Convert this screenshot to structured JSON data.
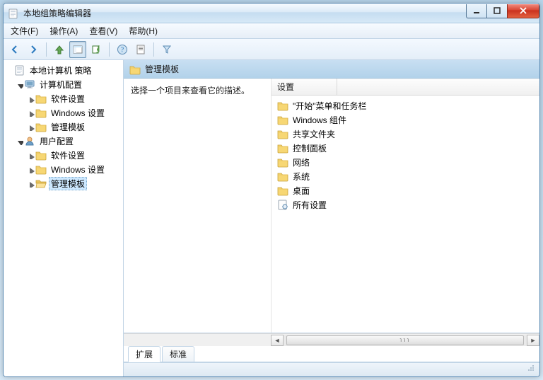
{
  "window": {
    "title": "本地组策略编辑器"
  },
  "menus": {
    "file": "文件(F)",
    "action": "操作(A)",
    "view": "查看(V)",
    "help": "帮助(H)"
  },
  "tree": {
    "root": "本地计算机 策略",
    "computer": {
      "label": "计算机配置",
      "software": "软件设置",
      "windows": "Windows 设置",
      "admin": "管理模板"
    },
    "user": {
      "label": "用户配置",
      "software": "软件设置",
      "windows": "Windows 设置",
      "admin": "管理模板"
    }
  },
  "header": {
    "title": "管理模板"
  },
  "description": {
    "text": "选择一个项目来查看它的描述。"
  },
  "list": {
    "column": "设置",
    "items": [
      {
        "icon": "folder",
        "label": "\"开始\"菜单和任务栏"
      },
      {
        "icon": "folder",
        "label": "Windows 组件"
      },
      {
        "icon": "folder",
        "label": "共享文件夹"
      },
      {
        "icon": "folder",
        "label": "控制面板"
      },
      {
        "icon": "folder",
        "label": "网络"
      },
      {
        "icon": "folder",
        "label": "系统"
      },
      {
        "icon": "folder",
        "label": "桌面"
      },
      {
        "icon": "settings",
        "label": "所有设置"
      }
    ]
  },
  "tabs": {
    "extended": "扩展",
    "standard": "标准"
  }
}
